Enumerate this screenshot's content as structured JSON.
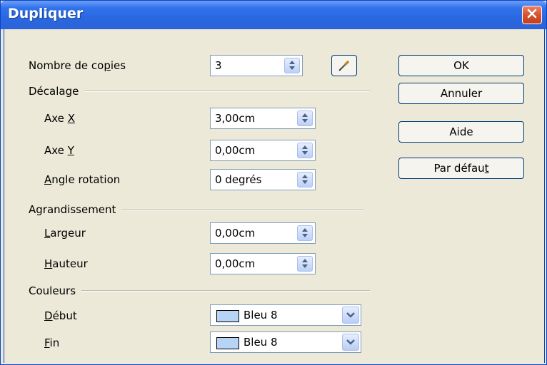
{
  "window": {
    "title": "Dupliquer",
    "accent": "#2a68e0"
  },
  "copies": {
    "label_pre": "Nombre de co",
    "label_mn": "p",
    "label_post": "ies",
    "value": "3"
  },
  "offset": {
    "section_label": "Décalage",
    "axe_x": {
      "label_pre": "Axe ",
      "label_mn": "X",
      "value": "3,00cm"
    },
    "axe_y": {
      "label_pre": "Axe ",
      "label_mn": "Y",
      "value": "0,00cm"
    },
    "angle": {
      "label_mn": "A",
      "label_post": "ngle rotation",
      "value": "0 degrés"
    }
  },
  "enlargement": {
    "section_label": "Agrandissement",
    "width": {
      "label_mn": "L",
      "label_post": "argeur",
      "value": "0,00cm"
    },
    "height": {
      "label_mn": "H",
      "label_post": "auteur",
      "value": "0,00cm"
    }
  },
  "colors": {
    "section_label": "Couleurs",
    "start": {
      "label_mn": "D",
      "label_post": "ébut",
      "value": "Bleu 8",
      "swatch": "#b8d4f4"
    },
    "end": {
      "label_mn": "F",
      "label_post": "in",
      "value": "Bleu 8",
      "swatch": "#b8d4f4"
    }
  },
  "buttons": {
    "ok": "OK",
    "cancel": "Annuler",
    "help": "Aide",
    "default_pre": "Par défau",
    "default_mn": "t"
  },
  "icons": {
    "close": "close-icon",
    "pipette": "eyedropper-icon",
    "spin": "spin-arrows-icon",
    "dropdown": "chevron-down-icon"
  }
}
